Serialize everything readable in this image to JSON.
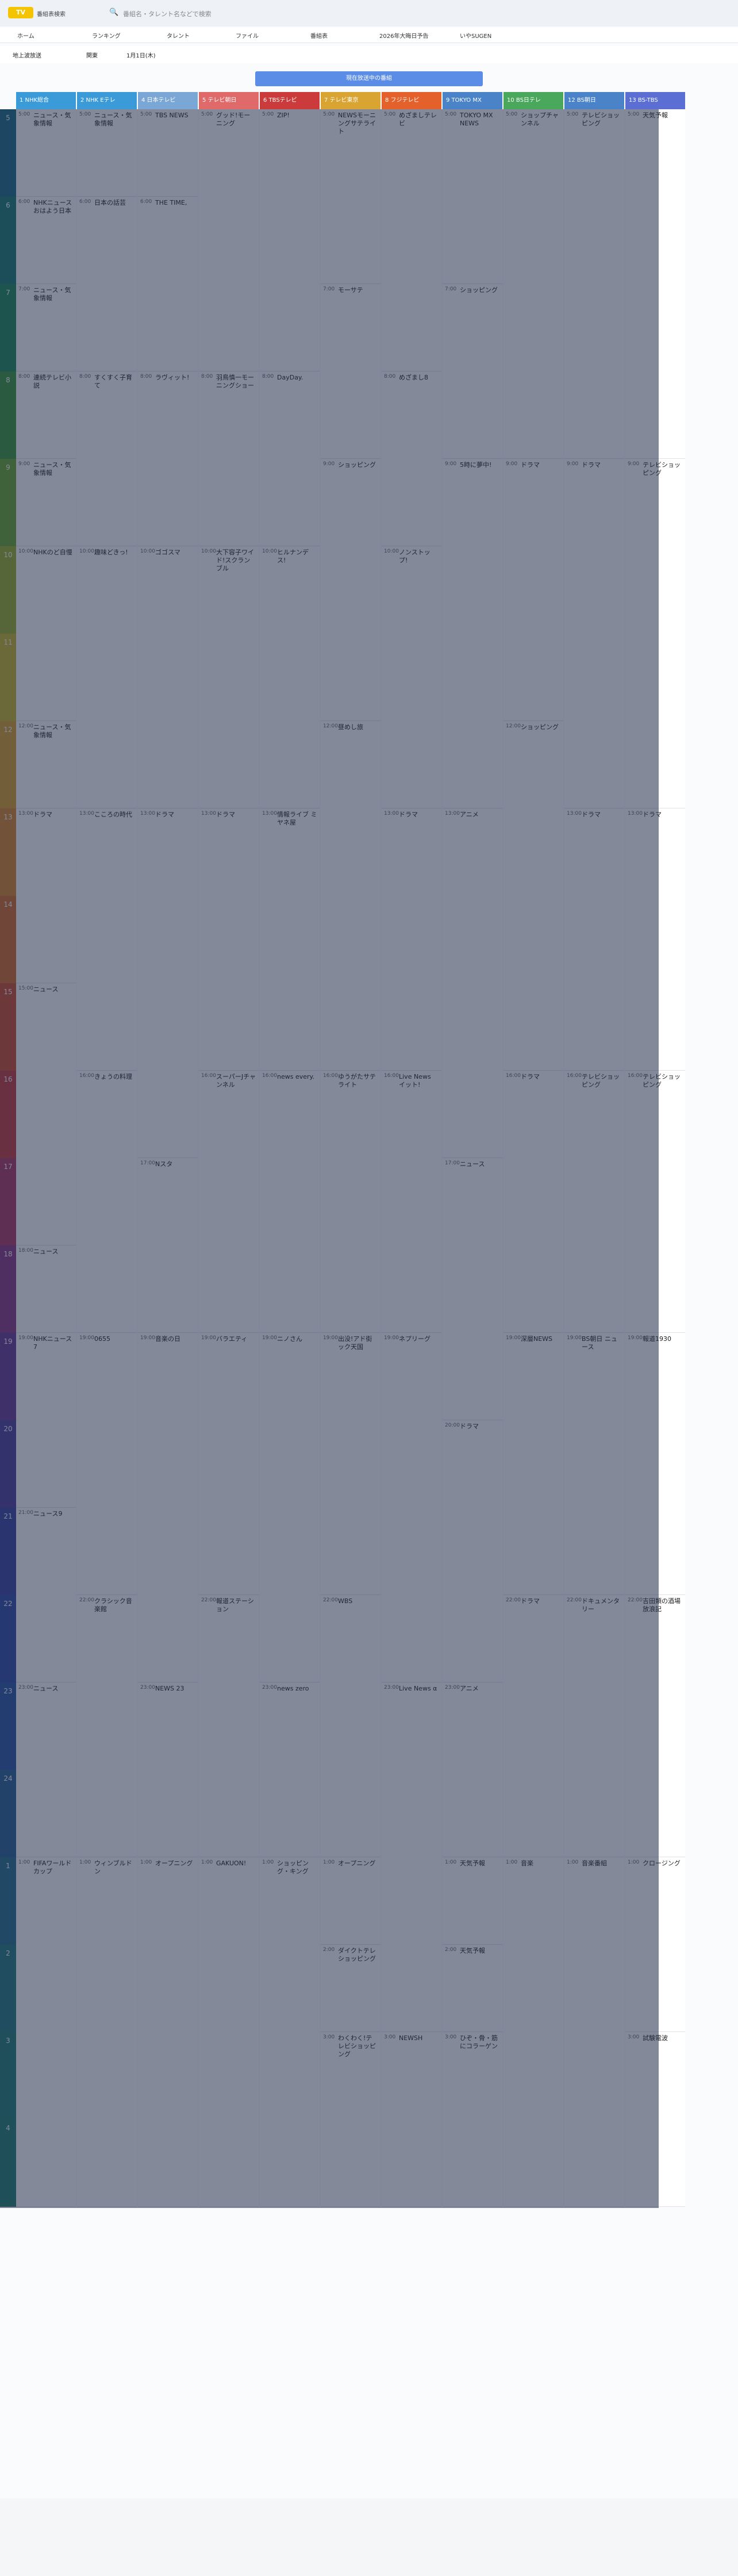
{
  "header": {
    "site": "番組表検索",
    "search_placeholder": "番組名・タレント名などで検索"
  },
  "nav": [
    "ホーム",
    "ランキング",
    "タレント",
    "ファイル",
    "番組表",
    "2026年大晦日予告",
    "いやSUGEN"
  ],
  "filters": {
    "area": "地上波放送",
    "region": "関東",
    "date": "1月1日(木)"
  },
  "banner": "現在放送中の番組",
  "channels": [
    {
      "label": "1 NHK総合",
      "color": "#3a9bd8"
    },
    {
      "label": "2 NHK Eテレ",
      "color": "#3a9bd8"
    },
    {
      "label": "4 日本テレビ",
      "color": "#7aa7d6"
    },
    {
      "label": "5 テレビ朝日",
      "color": "#e06a6a"
    },
    {
      "label": "6 TBSテレビ",
      "color": "#cc3b3b"
    },
    {
      "label": "7 テレビ東京",
      "color": "#d9a432"
    },
    {
      "label": "8 フジテレビ",
      "color": "#e5612c"
    },
    {
      "label": "9 TOKYO MX",
      "color": "#4a83c8"
    },
    {
      "label": "10 BS日テレ",
      "color": "#4aa85c"
    },
    {
      "label": "12 BS朝日",
      "color": "#4a83c8"
    },
    {
      "label": "13 BS-TBS",
      "color": "#5b6ed4"
    }
  ],
  "hours": [
    "5",
    "6",
    "7",
    "8",
    "9",
    "10",
    "11",
    "12",
    "13",
    "14",
    "15",
    "16",
    "17",
    "18",
    "19",
    "20",
    "21",
    "22",
    "23",
    "24",
    "1",
    "2",
    "3",
    "4"
  ],
  "programs": [
    [
      {
        "time": "5:00",
        "name": "ニュース・気象情報"
      },
      {
        "time": "6:00",
        "name": "NHKニュース おはよう日本"
      },
      {
        "time": "7:00",
        "name": "ニュース・気象情報"
      },
      {
        "time": "8:00",
        "name": "連続テレビ小説"
      },
      {
        "time": "9:00",
        "name": "ニュース・気象情報"
      },
      {
        "time": "10:00",
        "name": "NHKのど自慢"
      },
      {
        "time": "12:00",
        "name": "ニュース・気象情報"
      },
      {
        "time": "13:00",
        "name": "ドラマ"
      },
      {
        "time": "15:00",
        "name": "ニュース"
      },
      {
        "time": "18:00",
        "name": "ニュース"
      },
      {
        "time": "19:00",
        "name": "NHKニュース7"
      },
      {
        "time": "21:00",
        "name": "ニュース9"
      },
      {
        "time": "23:00",
        "name": "ニュース"
      },
      {
        "time": "1:00",
        "name": "FIFAワールドカップ"
      }
    ],
    [
      {
        "time": "5:00",
        "name": "ニュース・気象情報"
      },
      {
        "time": "6:00",
        "name": "日本の話芸"
      },
      {
        "time": "8:00",
        "name": "すくすく子育て"
      },
      {
        "time": "10:00",
        "name": "趣味どきっ!"
      },
      {
        "time": "13:00",
        "name": "こころの時代"
      },
      {
        "time": "16:00",
        "name": "きょうの料理"
      },
      {
        "time": "19:00",
        "name": "0655"
      },
      {
        "time": "22:00",
        "name": "クラシック音楽館"
      },
      {
        "time": "1:00",
        "name": "ウィンブルドン"
      }
    ],
    [
      {
        "time": "5:00",
        "name": "TBS NEWS"
      },
      {
        "time": "6:00",
        "name": "THE TIME,"
      },
      {
        "time": "8:00",
        "name": "ラヴィット!"
      },
      {
        "time": "10:00",
        "name": "ゴゴスマ"
      },
      {
        "time": "13:00",
        "name": "ドラマ"
      },
      {
        "time": "17:00",
        "name": "Nスタ"
      },
      {
        "time": "19:00",
        "name": "音楽の日"
      },
      {
        "time": "23:00",
        "name": "NEWS 23"
      },
      {
        "time": "1:00",
        "name": "オープニング"
      }
    ],
    [
      {
        "time": "5:00",
        "name": "グッド!モーニング"
      },
      {
        "time": "8:00",
        "name": "羽鳥慎一モーニングショー"
      },
      {
        "time": "10:00",
        "name": "大下容子ワイド!スクランブル"
      },
      {
        "time": "13:00",
        "name": "ドラマ"
      },
      {
        "time": "16:00",
        "name": "スーパーJチャンネル"
      },
      {
        "time": "19:00",
        "name": "バラエティ"
      },
      {
        "time": "22:00",
        "name": "報道ステーション"
      },
      {
        "time": "1:00",
        "name": "GAKUON!"
      }
    ],
    [
      {
        "time": "5:00",
        "name": "ZIP!"
      },
      {
        "time": "8:00",
        "name": "DayDay."
      },
      {
        "time": "10:00",
        "name": "ヒルナンデス!"
      },
      {
        "time": "13:00",
        "name": "情報ライブ ミヤネ屋"
      },
      {
        "time": "16:00",
        "name": "news every."
      },
      {
        "time": "19:00",
        "name": "ニノさん"
      },
      {
        "time": "23:00",
        "name": "news zero"
      },
      {
        "time": "1:00",
        "name": "ショッピング・キング"
      }
    ],
    [
      {
        "time": "5:00",
        "name": "NEWSモーニングサテライト"
      },
      {
        "time": "7:00",
        "name": "モーサテ"
      },
      {
        "time": "9:00",
        "name": "ショッピング"
      },
      {
        "time": "12:00",
        "name": "昼めし旅"
      },
      {
        "time": "16:00",
        "name": "ゆうがたサテライト"
      },
      {
        "time": "19:00",
        "name": "出没!アド街ック天国"
      },
      {
        "time": "22:00",
        "name": "WBS"
      },
      {
        "time": "1:00",
        "name": "オープニング"
      },
      {
        "time": "2:00",
        "name": "ダイクトテレショッピング"
      },
      {
        "time": "3:00",
        "name": "わくわく!テレビショッピング"
      }
    ],
    [
      {
        "time": "5:00",
        "name": "めざましテレビ"
      },
      {
        "time": "8:00",
        "name": "めざまし8"
      },
      {
        "time": "10:00",
        "name": "ノンストップ!"
      },
      {
        "time": "13:00",
        "name": "ドラマ"
      },
      {
        "time": "16:00",
        "name": "Live News イット!"
      },
      {
        "time": "19:00",
        "name": "ネプリーグ"
      },
      {
        "time": "23:00",
        "name": "Live News α"
      },
      {
        "time": "3:00",
        "name": "NEWSH"
      }
    ],
    [
      {
        "time": "5:00",
        "name": "TOKYO MX NEWS"
      },
      {
        "time": "7:00",
        "name": "ショッピング"
      },
      {
        "time": "9:00",
        "name": "5時に夢中!"
      },
      {
        "time": "13:00",
        "name": "アニメ"
      },
      {
        "time": "17:00",
        "name": "ニュース"
      },
      {
        "time": "20:00",
        "name": "ドラマ"
      },
      {
        "time": "23:00",
        "name": "アニメ"
      },
      {
        "time": "1:00",
        "name": "天気予報"
      },
      {
        "time": "2:00",
        "name": "天気予報"
      },
      {
        "time": "3:00",
        "name": "ひぞ・骨・筋にコラーゲン"
      }
    ],
    [
      {
        "time": "5:00",
        "name": "ショップチャンネル"
      },
      {
        "time": "9:00",
        "name": "ドラマ"
      },
      {
        "time": "12:00",
        "name": "ショッピング"
      },
      {
        "time": "16:00",
        "name": "ドラマ"
      },
      {
        "time": "19:00",
        "name": "深層NEWS"
      },
      {
        "time": "22:00",
        "name": "ドラマ"
      },
      {
        "time": "1:00",
        "name": "音楽"
      }
    ],
    [
      {
        "time": "5:00",
        "name": "テレビショッピング"
      },
      {
        "time": "9:00",
        "name": "ドラマ"
      },
      {
        "time": "13:00",
        "name": "ドラマ"
      },
      {
        "time": "16:00",
        "name": "テレビショッピング"
      },
      {
        "time": "19:00",
        "name": "BS朝日 ニュース"
      },
      {
        "time": "22:00",
        "name": "ドキュメンタリー"
      },
      {
        "time": "1:00",
        "name": "音楽番組"
      }
    ],
    [
      {
        "time": "5:00",
        "name": "天気予報"
      },
      {
        "time": "9:00",
        "name": "テレビショッピング"
      },
      {
        "time": "13:00",
        "name": "ドラマ"
      },
      {
        "time": "16:00",
        "name": "テレビショッピング"
      },
      {
        "time": "19:00",
        "name": "報道1930"
      },
      {
        "time": "22:00",
        "name": "吉田類の酒場放浪記"
      },
      {
        "time": "1:00",
        "name": "クロージング"
      },
      {
        "time": "3:00",
        "name": "試験電波"
      }
    ]
  ]
}
